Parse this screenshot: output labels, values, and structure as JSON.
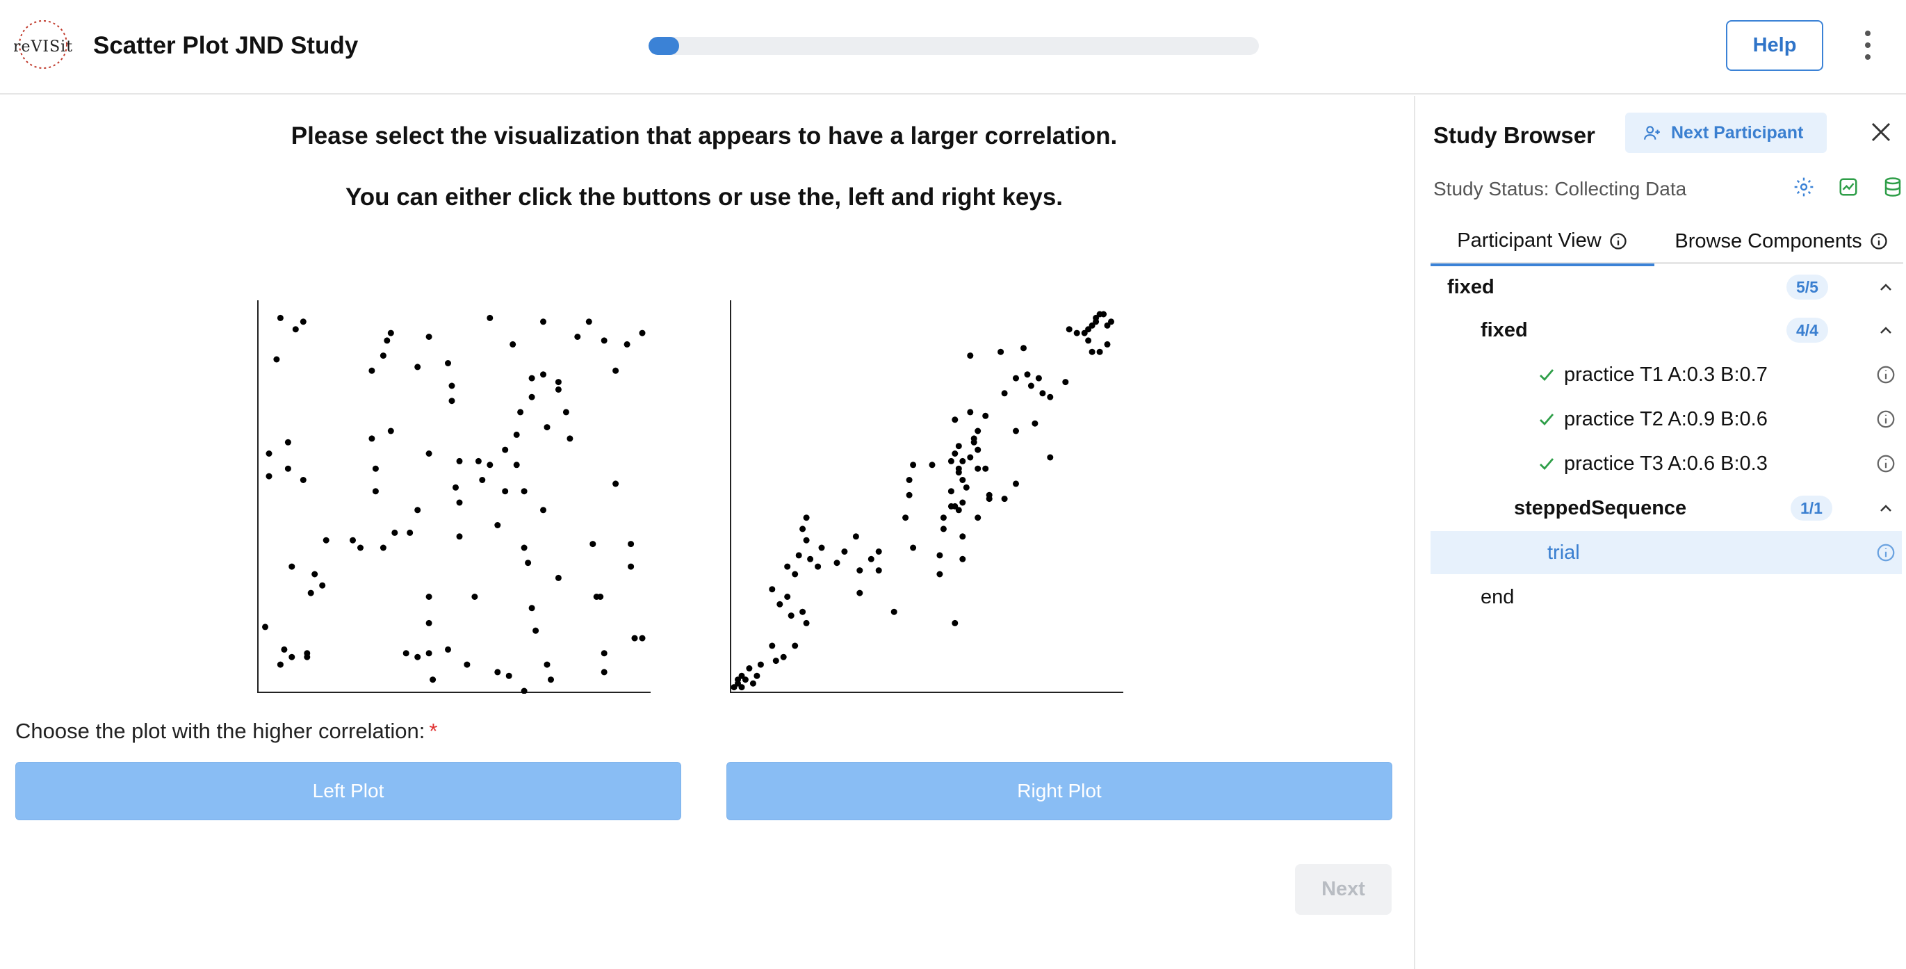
{
  "header": {
    "logo_text": "ReVISit",
    "title": "Scatter Plot JND Study",
    "progress_percent": 5,
    "help_label": "Help"
  },
  "main": {
    "prompt_line1": "Please select the visualization that appears to have a larger correlation.",
    "prompt_line2": "You can either click the buttons or use the, left and right keys.",
    "question_label": "Choose the plot with the higher correlation:",
    "required_marker": "*",
    "left_button": "Left Plot",
    "right_button": "Right Plot",
    "next_button": "Next"
  },
  "chart_data": [
    {
      "type": "scatter",
      "title": "",
      "xlim": [
        0,
        1
      ],
      "ylim": [
        0,
        1
      ],
      "points": [
        [
          0.05,
          0.99
        ],
        [
          0.09,
          0.96
        ],
        [
          0.11,
          0.98
        ],
        [
          0.04,
          0.88
        ],
        [
          0.34,
          0.95
        ],
        [
          0.33,
          0.93
        ],
        [
          0.32,
          0.89
        ],
        [
          0.44,
          0.94
        ],
        [
          0.6,
          0.99
        ],
        [
          0.66,
          0.92
        ],
        [
          0.74,
          0.98
        ],
        [
          0.86,
          0.98
        ],
        [
          0.9,
          0.93
        ],
        [
          0.96,
          0.92
        ],
        [
          1.0,
          0.95
        ],
        [
          0.83,
          0.94
        ],
        [
          0.93,
          0.85
        ],
        [
          0.29,
          0.85
        ],
        [
          0.41,
          0.86
        ],
        [
          0.49,
          0.87
        ],
        [
          0.5,
          0.81
        ],
        [
          0.5,
          0.77
        ],
        [
          0.71,
          0.83
        ],
        [
          0.74,
          0.84
        ],
        [
          0.78,
          0.82
        ],
        [
          0.78,
          0.8
        ],
        [
          0.71,
          0.78
        ],
        [
          0.68,
          0.74
        ],
        [
          0.8,
          0.74
        ],
        [
          0.75,
          0.7
        ],
        [
          0.81,
          0.67
        ],
        [
          0.67,
          0.68
        ],
        [
          0.34,
          0.69
        ],
        [
          0.29,
          0.67
        ],
        [
          0.07,
          0.66
        ],
        [
          0.02,
          0.63
        ],
        [
          0.44,
          0.63
        ],
        [
          0.52,
          0.61
        ],
        [
          0.57,
          0.61
        ],
        [
          0.64,
          0.64
        ],
        [
          0.67,
          0.6
        ],
        [
          0.58,
          0.56
        ],
        [
          0.51,
          0.54
        ],
        [
          0.64,
          0.53
        ],
        [
          0.6,
          0.6
        ],
        [
          0.69,
          0.53
        ],
        [
          0.02,
          0.57
        ],
        [
          0.07,
          0.59
        ],
        [
          0.11,
          0.56
        ],
        [
          0.3,
          0.59
        ],
        [
          0.3,
          0.53
        ],
        [
          0.93,
          0.55
        ],
        [
          0.41,
          0.48
        ],
        [
          0.52,
          0.5
        ],
        [
          0.62,
          0.44
        ],
        [
          0.74,
          0.48
        ],
        [
          0.69,
          0.38
        ],
        [
          0.52,
          0.41
        ],
        [
          0.7,
          0.34
        ],
        [
          0.24,
          0.4
        ],
        [
          0.26,
          0.38
        ],
        [
          0.32,
          0.38
        ],
        [
          0.39,
          0.42
        ],
        [
          0.35,
          0.42
        ],
        [
          0.87,
          0.39
        ],
        [
          0.97,
          0.39
        ],
        [
          0.17,
          0.4
        ],
        [
          0.08,
          0.33
        ],
        [
          0.14,
          0.31
        ],
        [
          0.16,
          0.28
        ],
        [
          0.13,
          0.26
        ],
        [
          0.97,
          0.33
        ],
        [
          0.78,
          0.3
        ],
        [
          0.44,
          0.25
        ],
        [
          0.56,
          0.25
        ],
        [
          0.88,
          0.25
        ],
        [
          0.89,
          0.25
        ],
        [
          0.71,
          0.22
        ],
        [
          0.01,
          0.17
        ],
        [
          0.06,
          0.11
        ],
        [
          0.08,
          0.09
        ],
        [
          0.12,
          0.1
        ],
        [
          0.12,
          0.09
        ],
        [
          0.38,
          0.1
        ],
        [
          0.41,
          0.09
        ],
        [
          0.44,
          0.1
        ],
        [
          0.49,
          0.11
        ],
        [
          0.44,
          0.18
        ],
        [
          0.72,
          0.16
        ],
        [
          0.98,
          0.14
        ],
        [
          1.0,
          0.14
        ],
        [
          0.9,
          0.1
        ],
        [
          0.9,
          0.05
        ],
        [
          0.05,
          0.07
        ],
        [
          0.45,
          0.03
        ],
        [
          0.54,
          0.07
        ],
        [
          0.62,
          0.05
        ],
        [
          0.65,
          0.04
        ],
        [
          0.75,
          0.07
        ],
        [
          0.76,
          0.03
        ],
        [
          0.69,
          0.0
        ]
      ]
    },
    {
      "type": "scatter",
      "title": "",
      "xlim": [
        0,
        1
      ],
      "ylim": [
        0,
        1
      ],
      "points": [
        [
          0.0,
          0.01
        ],
        [
          0.01,
          0.02
        ],
        [
          0.02,
          0.01
        ],
        [
          0.03,
          0.03
        ],
        [
          0.04,
          0.06
        ],
        [
          0.05,
          0.02
        ],
        [
          0.06,
          0.04
        ],
        [
          0.07,
          0.07
        ],
        [
          0.02,
          0.04
        ],
        [
          0.01,
          0.03
        ],
        [
          0.11,
          0.08
        ],
        [
          0.13,
          0.09
        ],
        [
          0.16,
          0.12
        ],
        [
          0.1,
          0.12
        ],
        [
          0.19,
          0.18
        ],
        [
          0.15,
          0.2
        ],
        [
          0.12,
          0.23
        ],
        [
          0.18,
          0.21
        ],
        [
          0.14,
          0.25
        ],
        [
          0.1,
          0.27
        ],
        [
          0.16,
          0.31
        ],
        [
          0.14,
          0.33
        ],
        [
          0.17,
          0.36
        ],
        [
          0.22,
          0.33
        ],
        [
          0.2,
          0.35
        ],
        [
          0.23,
          0.38
        ],
        [
          0.27,
          0.34
        ],
        [
          0.29,
          0.37
        ],
        [
          0.32,
          0.41
        ],
        [
          0.33,
          0.32
        ],
        [
          0.36,
          0.35
        ],
        [
          0.38,
          0.37
        ],
        [
          0.38,
          0.32
        ],
        [
          0.19,
          0.4
        ],
        [
          0.18,
          0.43
        ],
        [
          0.19,
          0.46
        ],
        [
          0.33,
          0.26
        ],
        [
          0.42,
          0.21
        ],
        [
          0.47,
          0.38
        ],
        [
          0.45,
          0.46
        ],
        [
          0.46,
          0.52
        ],
        [
          0.46,
          0.56
        ],
        [
          0.47,
          0.6
        ],
        [
          0.52,
          0.6
        ],
        [
          0.55,
          0.43
        ],
        [
          0.54,
          0.31
        ],
        [
          0.54,
          0.36
        ],
        [
          0.55,
          0.46
        ],
        [
          0.57,
          0.49
        ],
        [
          0.58,
          0.49
        ],
        [
          0.6,
          0.5
        ],
        [
          0.61,
          0.54
        ],
        [
          0.59,
          0.58
        ],
        [
          0.6,
          0.61
        ],
        [
          0.62,
          0.62
        ],
        [
          0.57,
          0.61
        ],
        [
          0.58,
          0.63
        ],
        [
          0.59,
          0.65
        ],
        [
          0.63,
          0.66
        ],
        [
          0.64,
          0.69
        ],
        [
          0.66,
          0.73
        ],
        [
          0.59,
          0.59
        ],
        [
          0.64,
          0.59
        ],
        [
          0.6,
          0.56
        ],
        [
          0.58,
          0.72
        ],
        [
          0.62,
          0.74
        ],
        [
          0.63,
          0.67
        ],
        [
          0.64,
          0.64
        ],
        [
          0.66,
          0.59
        ],
        [
          0.57,
          0.53
        ],
        [
          0.59,
          0.48
        ],
        [
          0.6,
          0.41
        ],
        [
          0.6,
          0.35
        ],
        [
          0.58,
          0.18
        ],
        [
          0.64,
          0.46
        ],
        [
          0.67,
          0.52
        ],
        [
          0.67,
          0.51
        ],
        [
          0.71,
          0.51
        ],
        [
          0.74,
          0.55
        ],
        [
          0.74,
          0.69
        ],
        [
          0.79,
          0.71
        ],
        [
          0.71,
          0.79
        ],
        [
          0.74,
          0.83
        ],
        [
          0.77,
          0.84
        ],
        [
          0.8,
          0.83
        ],
        [
          0.81,
          0.79
        ],
        [
          0.83,
          0.78
        ],
        [
          0.78,
          0.81
        ],
        [
          0.83,
          0.62
        ],
        [
          0.87,
          0.82
        ],
        [
          0.7,
          0.9
        ],
        [
          0.76,
          0.91
        ],
        [
          0.62,
          0.89
        ],
        [
          0.88,
          0.96
        ],
        [
          0.9,
          0.95
        ],
        [
          0.92,
          0.95
        ],
        [
          0.93,
          0.96
        ],
        [
          0.94,
          0.97
        ],
        [
          0.95,
          0.98
        ],
        [
          0.96,
          1.0
        ],
        [
          0.97,
          1.0
        ],
        [
          0.95,
          0.99
        ],
        [
          0.93,
          0.93
        ],
        [
          0.94,
          0.9
        ],
        [
          0.96,
          0.9
        ],
        [
          0.98,
          0.92
        ],
        [
          0.98,
          0.97
        ],
        [
          0.99,
          0.98
        ]
      ]
    }
  ],
  "sidebar": {
    "title": "Study Browser",
    "next_participant": "Next Participant",
    "status": "Study Status: Collecting Data",
    "tabs": [
      "Participant View",
      "Browse Components"
    ],
    "tree": [
      {
        "label": "fixed",
        "badge": "5/5"
      },
      {
        "label": "fixed",
        "badge": "4/4"
      },
      {
        "label": "practice T1 A:0.3 B:0.7"
      },
      {
        "label": "practice T2 A:0.9 B:0.6"
      },
      {
        "label": "practice T3 A:0.6 B:0.3"
      },
      {
        "label": "steppedSequence",
        "badge": "1/1"
      },
      {
        "label": "trial"
      },
      {
        "label": "end"
      }
    ]
  }
}
